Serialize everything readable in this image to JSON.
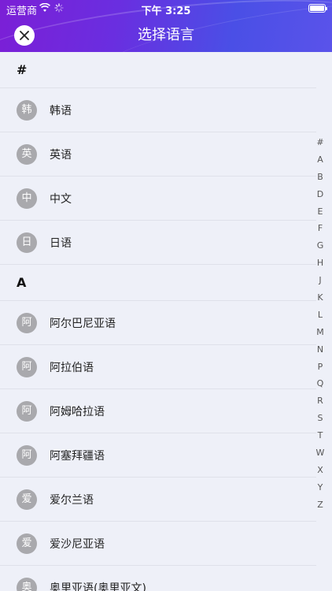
{
  "status_bar": {
    "carrier": "运营商",
    "time": "下午 3:25"
  },
  "nav": {
    "title": "选择语言",
    "close_icon": "close-icon"
  },
  "sections": [
    {
      "header": "#",
      "items": [
        {
          "avatar": "韩",
          "label": "韩语"
        },
        {
          "avatar": "英",
          "label": "英语"
        },
        {
          "avatar": "中",
          "label": "中文"
        },
        {
          "avatar": "日",
          "label": "日语"
        }
      ]
    },
    {
      "header": "A",
      "items": [
        {
          "avatar": "阿",
          "label": "阿尔巴尼亚语"
        },
        {
          "avatar": "阿",
          "label": "阿拉伯语"
        },
        {
          "avatar": "阿",
          "label": "阿姆哈拉语"
        },
        {
          "avatar": "阿",
          "label": "阿塞拜疆语"
        },
        {
          "avatar": "爱",
          "label": "爱尔兰语"
        },
        {
          "avatar": "爱",
          "label": "爱沙尼亚语"
        },
        {
          "avatar": "奥",
          "label": "奥里亚语(奥里亚文)"
        }
      ]
    }
  ],
  "index_letters": [
    "#",
    "A",
    "B",
    "D",
    "E",
    "F",
    "G",
    "H",
    "J",
    "K",
    "L",
    "M",
    "N",
    "P",
    "Q",
    "R",
    "S",
    "T",
    "W",
    "X",
    "Y",
    "Z"
  ],
  "colors": {
    "header_gradient_start": "#7b1fd6",
    "header_gradient_end": "#5a53ea",
    "avatar_bg": "#a9a9ad",
    "page_bg": "#eef0f8"
  }
}
